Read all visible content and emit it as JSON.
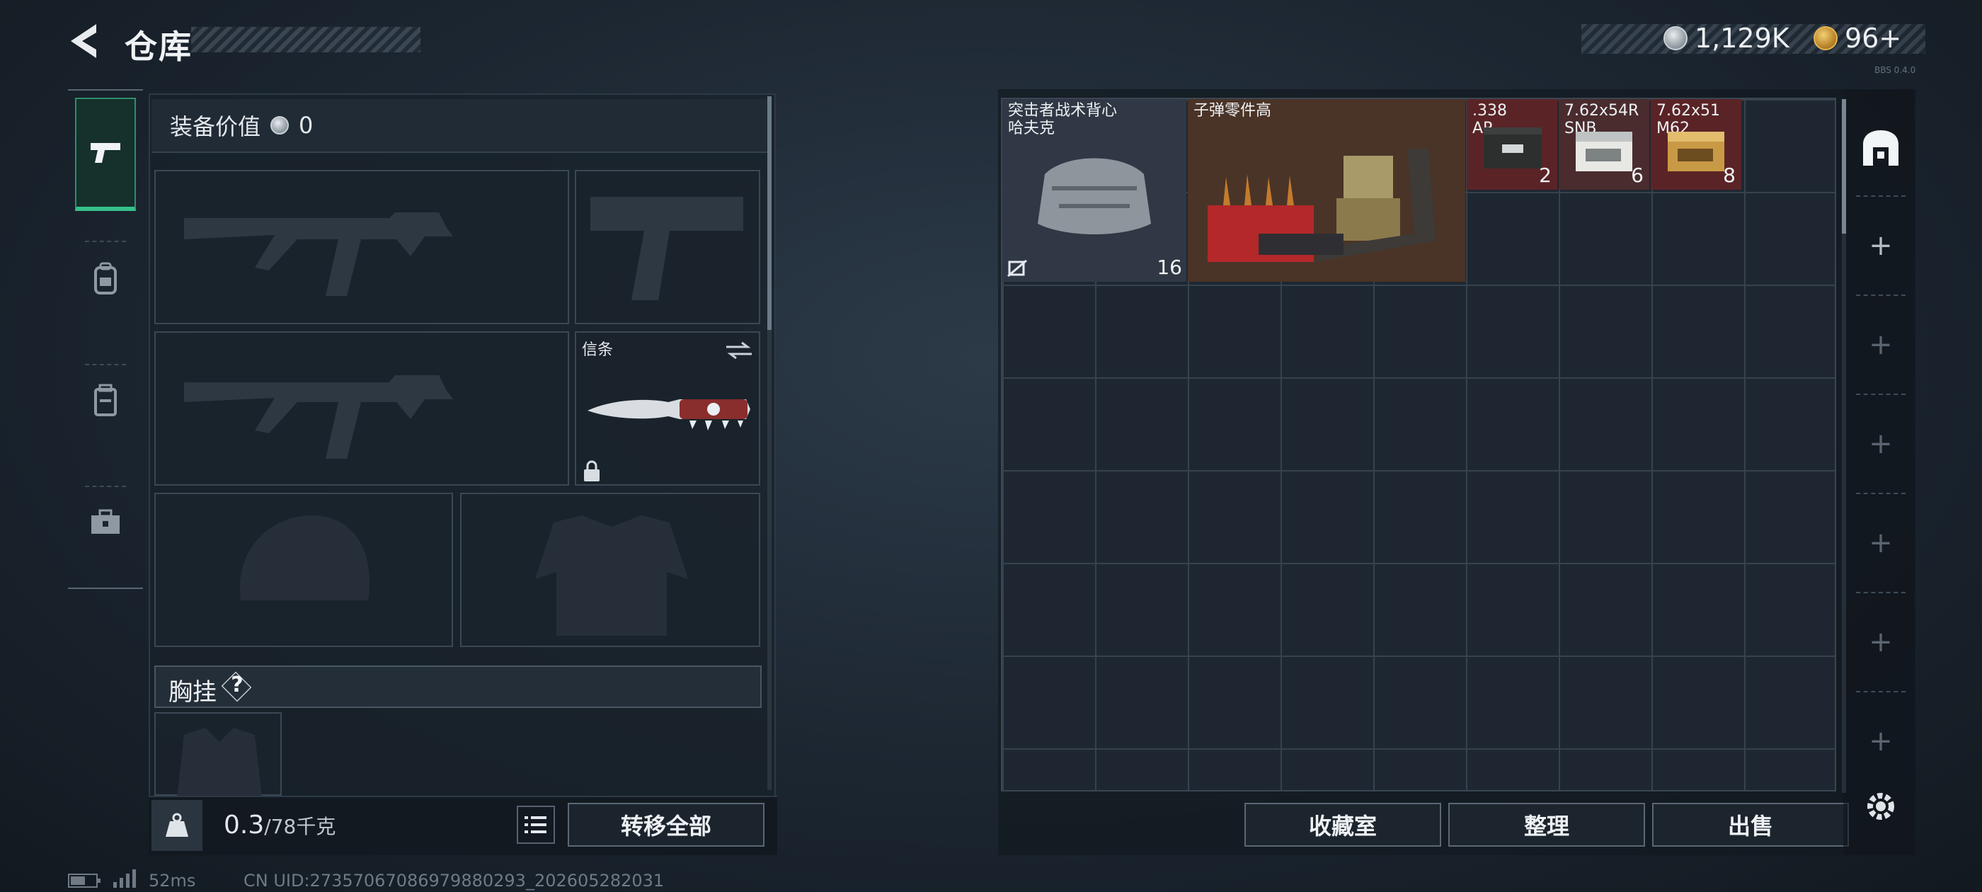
{
  "header": {
    "title": "仓库",
    "currency_silver": "1,129K",
    "currency_gold": "96+",
    "version_tag": "BBS 0.4.0"
  },
  "left_rail": [
    {
      "name": "weapons"
    },
    {
      "name": "backpack"
    },
    {
      "name": "containers"
    },
    {
      "name": "kits"
    }
  ],
  "equipment": {
    "value_label": "装备价值",
    "value": "0",
    "knife_slot_label": "信条",
    "chest_rig_label": "胸挂",
    "help_symbol": "?",
    "weight_current": "0.3",
    "weight_max": "/78千克",
    "transfer_all_label": "转移全部"
  },
  "stash": {
    "items": [
      {
        "name": "突击者战术背心\n哈夫克",
        "count": "16"
      },
      {
        "name": "子弹零件高",
        "count": ""
      },
      {
        "name": ".338\nAP",
        "count": "2"
      },
      {
        "name": "7.62x54R\nSNB",
        "count": "6"
      },
      {
        "name": "7.62x51\nM62",
        "count": "8"
      }
    ],
    "buttons": {
      "collection": "收藏室",
      "sort": "整理",
      "sell": "出售"
    }
  },
  "status": {
    "ping": "52ms",
    "uid": "CN UID:27357067086979880293_202605282031"
  },
  "colors": {
    "accent_green": "#36c08a",
    "red_item_bg": "#5a2427",
    "orange_item_bg": "#4a3427"
  }
}
